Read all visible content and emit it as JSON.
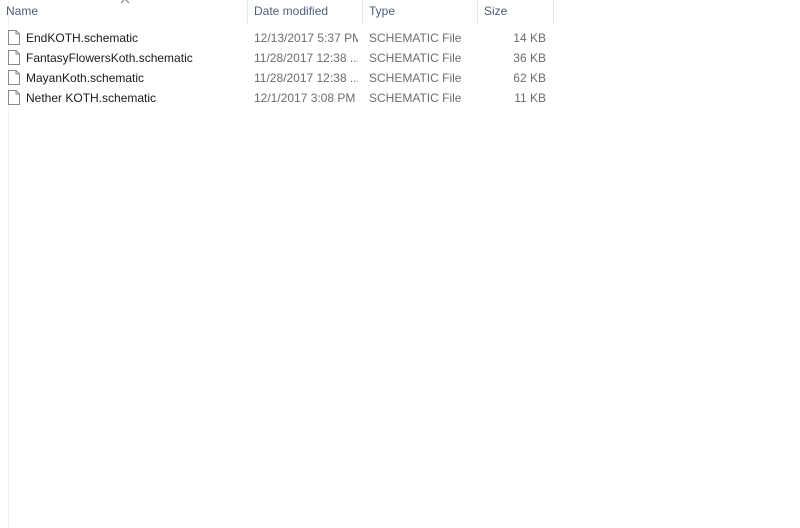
{
  "columns": {
    "name": "Name",
    "date_modified": "Date modified",
    "type": "Type",
    "size": "Size"
  },
  "sort": {
    "column": "name",
    "icon": "chevron-up-icon"
  },
  "files": [
    {
      "name": "EndKOTH.schematic",
      "date": "12/13/2017 5:37 PM",
      "type": "SCHEMATIC File",
      "size": "14 KB",
      "icon": "file-icon"
    },
    {
      "name": "FantasyFlowersKoth.schematic",
      "date": "11/28/2017 12:38 ...",
      "type": "SCHEMATIC File",
      "size": "36 KB",
      "icon": "file-icon"
    },
    {
      "name": "MayanKoth.schematic",
      "date": "11/28/2017 12:38 ...",
      "type": "SCHEMATIC File",
      "size": "62 KB",
      "icon": "file-icon"
    },
    {
      "name": "Nether KOTH.schematic",
      "date": "12/1/2017 3:08 PM",
      "type": "SCHEMATIC File",
      "size": "11 KB",
      "icon": "file-icon"
    }
  ]
}
